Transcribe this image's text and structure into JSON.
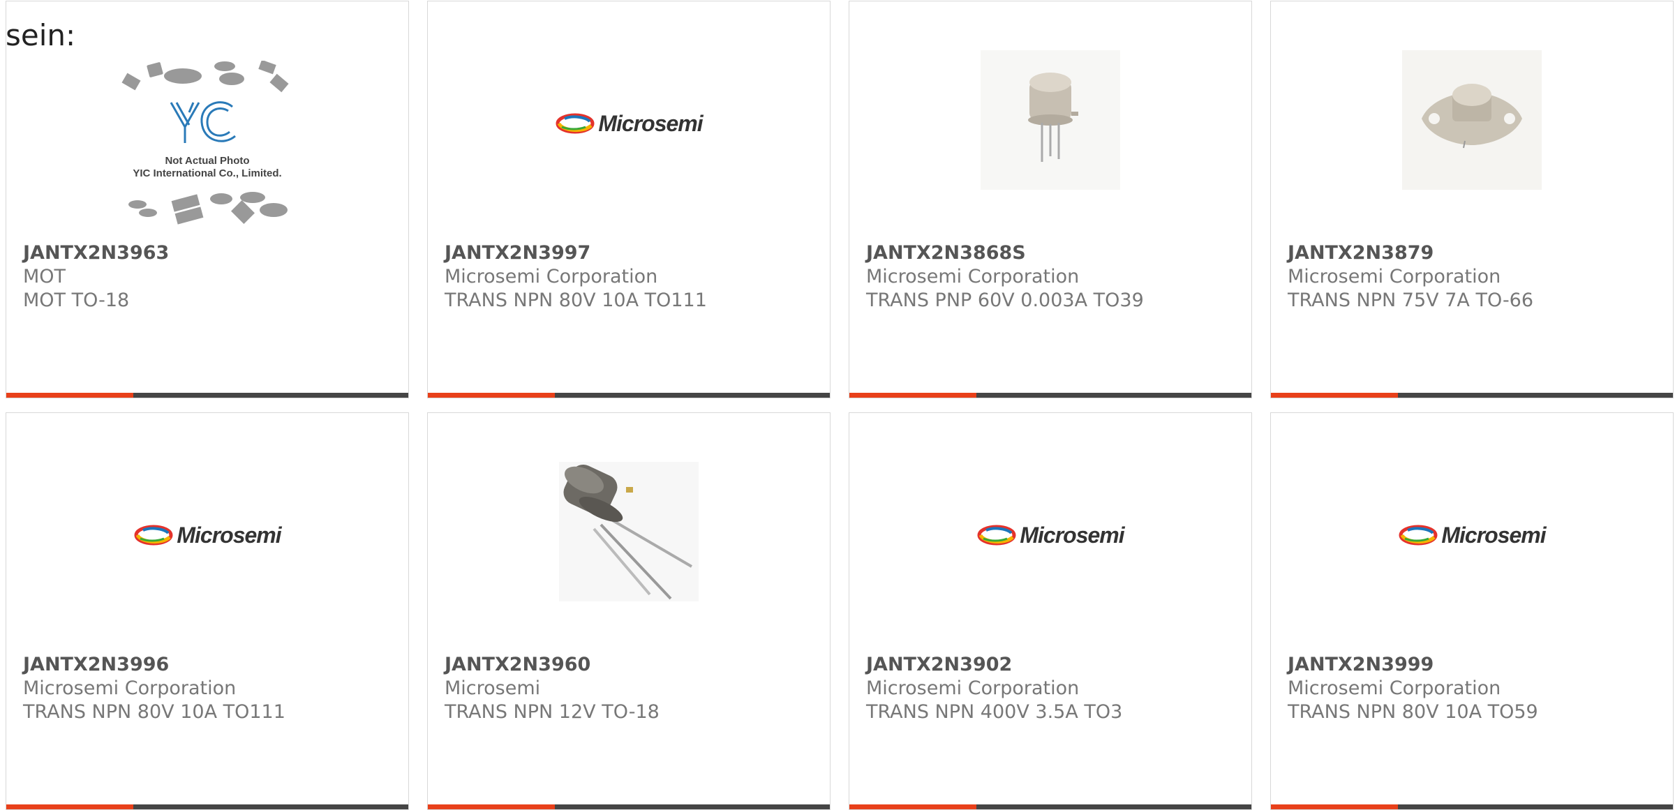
{
  "lead_text": "sein:",
  "cards": [
    {
      "part": "JANTX2N3963",
      "manufacturer": "MOT",
      "description": "MOT TO-18",
      "image": "placeholder-yic-icon",
      "placeholder_lines": [
        "Not Actual Photo",
        "YIC International Co., Limited."
      ]
    },
    {
      "part": "JANTX2N3997",
      "manufacturer": "Microsemi Corporation",
      "description": "TRANS NPN 80V 10A TO111",
      "image": "microsemi-logo",
      "logo_text": "Microsemi"
    },
    {
      "part": "JANTX2N3868S",
      "manufacturer": "Microsemi Corporation",
      "description": "TRANS PNP 60V 0.003A TO39",
      "image": "to39-transistor-icon"
    },
    {
      "part": "JANTX2N3879",
      "manufacturer": "Microsemi Corporation",
      "description": "TRANS NPN 75V 7A TO-66",
      "image": "to66-transistor-icon"
    },
    {
      "part": "JANTX2N3996",
      "manufacturer": "Microsemi Corporation",
      "description": "TRANS NPN 80V 10A TO111",
      "image": "microsemi-logo",
      "logo_text": "Microsemi"
    },
    {
      "part": "JANTX2N3960",
      "manufacturer": "Microsemi",
      "description": "TRANS NPN 12V TO-18",
      "image": "to18-transistor-icon"
    },
    {
      "part": "JANTX2N3902",
      "manufacturer": "Microsemi Corporation",
      "description": "TRANS NPN 400V 3.5A TO3",
      "image": "microsemi-logo",
      "logo_text": "Microsemi"
    },
    {
      "part": "JANTX2N3999",
      "manufacturer": "Microsemi Corporation",
      "description": "TRANS NPN 80V 10A TO59",
      "image": "microsemi-logo",
      "logo_text": "Microsemi"
    }
  ],
  "colors": {
    "accent": "#e8401a",
    "bar": "#454545",
    "border": "#d8d8d8",
    "part_text": "#555555",
    "meta_text": "#777777"
  }
}
